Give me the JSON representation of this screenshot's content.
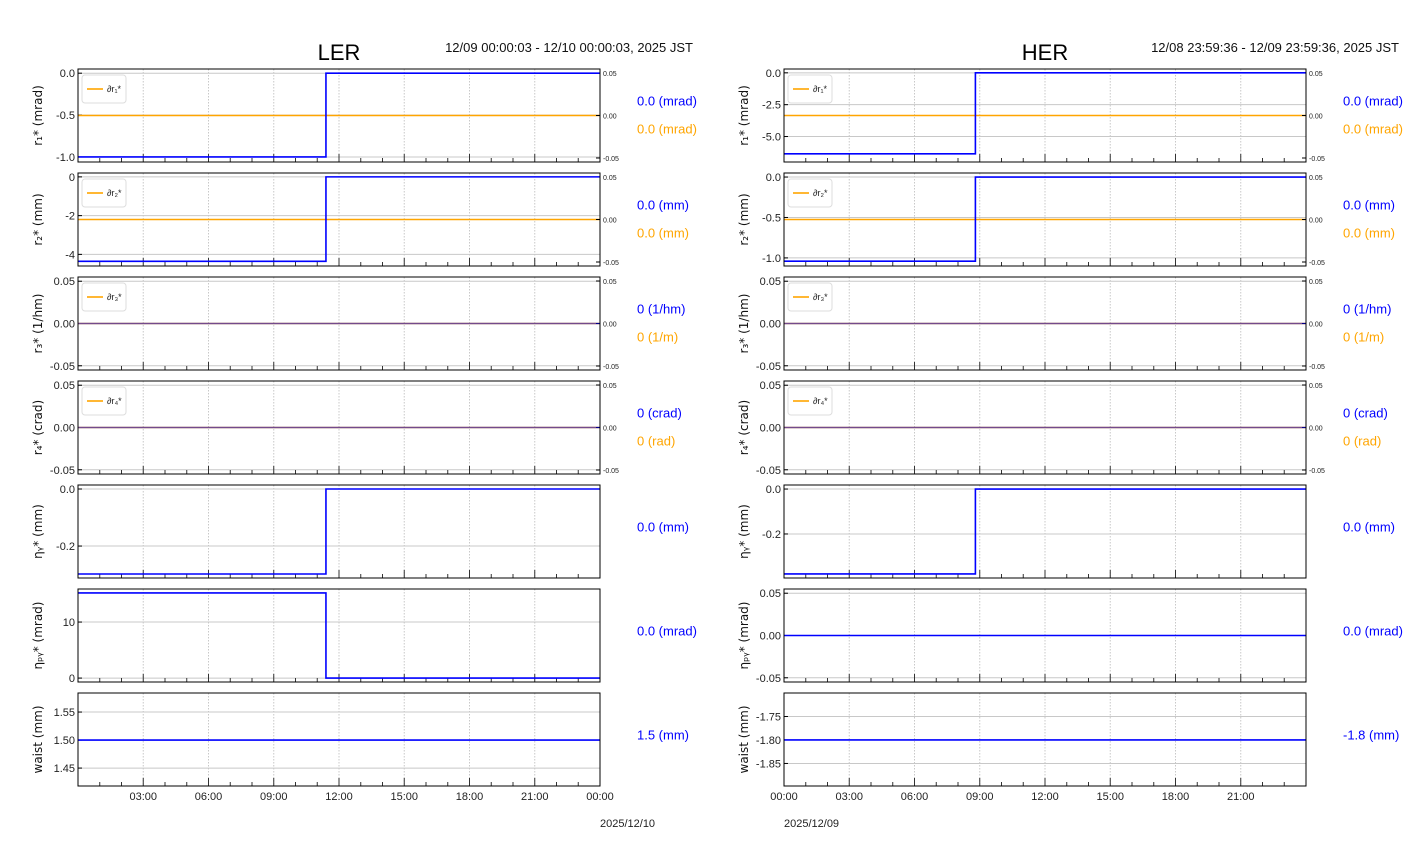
{
  "colors": {
    "blue": "#0000ff",
    "orange": "#ffa500",
    "grid": "#c8c8c8"
  },
  "chart_data": [
    {
      "type": "line",
      "title": "LER",
      "range_label": "12/09 00:00:03 - 12/10 00:00:03, 2025 JST",
      "date_label": "2025/12/10",
      "x_unit": "hours since 12/09 00:00:03",
      "xlim": [
        0,
        24
      ],
      "xticks": [
        {
          "h": 3,
          "label": "03:00"
        },
        {
          "h": 6,
          "label": "06:00"
        },
        {
          "h": 9,
          "label": "09:00"
        },
        {
          "h": 12,
          "label": "12:00"
        },
        {
          "h": 15,
          "label": "15:00"
        },
        {
          "h": 18,
          "label": "18:00"
        },
        {
          "h": 21,
          "label": "21:00"
        },
        {
          "h": 24,
          "label": "00:00"
        }
      ],
      "panels": [
        {
          "ylabel": "r₁* (mrad)",
          "ylim": [
            -1.06,
            0.05
          ],
          "yticks": [
            "0.0",
            "-0.5",
            "-1.0"
          ],
          "ytick_values": [
            0,
            -0.5,
            -1.0
          ],
          "step_at": 11.4,
          "before": -1.0,
          "after": 0.0,
          "orange": {
            "legend": "∂r₁*",
            "value": 0.0,
            "right_ticks": [
              "0.05",
              "0.00",
              "-0.05"
            ]
          },
          "blue_label": "0.0 (mrad)",
          "orange_label": "0.0 (mrad)"
        },
        {
          "ylabel": "r₂* (mm)",
          "ylim": [
            -4.6,
            0.2
          ],
          "yticks": [
            "0",
            "-2",
            "-4"
          ],
          "ytick_values": [
            0,
            -2,
            -4
          ],
          "step_at": 11.4,
          "before": -4.36,
          "after": 0.0,
          "orange": {
            "legend": "∂r₂*",
            "value": 0.0,
            "right_ticks": [
              "0.05",
              "0.00",
              "-0.05"
            ]
          },
          "blue_label": "0.0 (mm)",
          "orange_label": "0.0 (mm)"
        },
        {
          "ylabel": "r₃* (1/hm)",
          "ylim": [
            -0.055,
            0.055
          ],
          "yticks": [
            "0.05",
            "0.00",
            "-0.05"
          ],
          "ytick_values": [
            0.05,
            0,
            -0.05
          ],
          "step_at": null,
          "before": 0,
          "after": 0,
          "orange": {
            "legend": "∂r₃*",
            "value": 0.0,
            "right_ticks": [
              "0.05",
              "0.00",
              "-0.05"
            ]
          },
          "blue_label": "0 (1/hm)",
          "orange_label": "0 (1/m)"
        },
        {
          "ylabel": "r₄* (crad)",
          "ylim": [
            -0.055,
            0.055
          ],
          "yticks": [
            "0.05",
            "0.00",
            "-0.05"
          ],
          "ytick_values": [
            0.05,
            0,
            -0.05
          ],
          "step_at": null,
          "before": 0,
          "after": 0,
          "orange": {
            "legend": "∂r₄*",
            "value": 0.0,
            "right_ticks": [
              "0.05",
              "0.00",
              "-0.05"
            ]
          },
          "blue_label": "0 (crad)",
          "orange_label": "0 (rad)"
        },
        {
          "ylabel": "ηᵧ* (mm)",
          "ylim": [
            -0.312,
            0.014
          ],
          "yticks": [
            "0.0",
            "-0.2"
          ],
          "ytick_values": [
            0,
            -0.2
          ],
          "step_at": 11.4,
          "before": -0.298,
          "after": 0.0,
          "orange": null,
          "blue_label": "0.0 (mm)"
        },
        {
          "ylabel": "ηₚᵧ* (mrad)",
          "ylim": [
            -0.7,
            15.9
          ],
          "yticks": [
            "10",
            "0"
          ],
          "ytick_values": [
            10,
            0
          ],
          "step_at": 11.4,
          "before": 15.2,
          "after": 0.0,
          "orange": null,
          "blue_label": "0.0 (mrad)"
        },
        {
          "ylabel": "waist (mm)",
          "ylim": [
            1.418,
            1.584
          ],
          "yticks": [
            "1.55",
            "1.50",
            "1.45"
          ],
          "ytick_values": [
            1.55,
            1.5,
            1.45
          ],
          "step_at": null,
          "before": 1.5,
          "after": 1.5,
          "orange": null,
          "blue_label": "1.5 (mm)"
        }
      ]
    },
    {
      "type": "line",
      "title": "HER",
      "range_label": "12/08 23:59:36 - 12/09 23:59:36, 2025 JST",
      "date_label": "2025/12/09",
      "x_unit": "hours since 12/09 00:00:00",
      "xlim": [
        0,
        24
      ],
      "xticks": [
        {
          "h": 0,
          "label": "00:00"
        },
        {
          "h": 3,
          "label": "03:00"
        },
        {
          "h": 6,
          "label": "06:00"
        },
        {
          "h": 9,
          "label": "09:00"
        },
        {
          "h": 12,
          "label": "12:00"
        },
        {
          "h": 15,
          "label": "15:00"
        },
        {
          "h": 18,
          "label": "18:00"
        },
        {
          "h": 21,
          "label": "21:00"
        }
      ],
      "panels": [
        {
          "ylabel": "r₁* (mrad)",
          "ylim": [
            -7.0,
            0.3
          ],
          "yticks": [
            "0.0",
            "-2.5",
            "-5.0"
          ],
          "ytick_values": [
            0,
            -2.5,
            -5.0
          ],
          "step_at": 8.8,
          "before": -6.36,
          "after": 0.0,
          "orange": {
            "legend": "∂r₁*",
            "value": 0.0,
            "right_ticks": [
              "0.05",
              "0.00",
              "-0.05"
            ]
          },
          "blue_label": "0.0 (mrad)",
          "orange_label": "0.0 (mrad)"
        },
        {
          "ylabel": "r₂* (mm)",
          "ylim": [
            -1.1,
            0.05
          ],
          "yticks": [
            "0.0",
            "-0.5",
            "-1.0"
          ],
          "ytick_values": [
            0,
            -0.5,
            -1.0
          ],
          "step_at": 8.8,
          "before": -1.04,
          "after": 0.0,
          "orange": {
            "legend": "∂r₂*",
            "value": 0.0,
            "right_ticks": [
              "0.05",
              "0.00",
              "-0.05"
            ]
          },
          "blue_label": "0.0 (mm)",
          "orange_label": "0.0 (mm)"
        },
        {
          "ylabel": "r₃* (1/hm)",
          "ylim": [
            -0.055,
            0.055
          ],
          "yticks": [
            "0.05",
            "0.00",
            "-0.05"
          ],
          "ytick_values": [
            0.05,
            0,
            -0.05
          ],
          "step_at": null,
          "before": 0,
          "after": 0,
          "orange": {
            "legend": "∂r₃*",
            "value": 0.0,
            "right_ticks": [
              "0.05",
              "0.00",
              "-0.05"
            ]
          },
          "blue_label": "0 (1/hm)",
          "orange_label": "0 (1/m)"
        },
        {
          "ylabel": "r₄* (crad)",
          "ylim": [
            -0.055,
            0.055
          ],
          "yticks": [
            "0.05",
            "0.00",
            "-0.05"
          ],
          "ytick_values": [
            0.05,
            0,
            -0.05
          ],
          "step_at": null,
          "before": 0,
          "after": 0,
          "orange": {
            "legend": "∂r₄*",
            "value": 0.0,
            "right_ticks": [
              "0.05",
              "0.00",
              "-0.05"
            ]
          },
          "blue_label": "0 (crad)",
          "orange_label": "0 (rad)"
        },
        {
          "ylabel": "ηᵧ* (mm)",
          "ylim": [
            -0.396,
            0.018
          ],
          "yticks": [
            "0.0",
            "-0.2"
          ],
          "ytick_values": [
            0,
            -0.2
          ],
          "step_at": 8.8,
          "before": -0.378,
          "after": 0.0,
          "orange": null,
          "blue_label": "0.0 (mm)"
        },
        {
          "ylabel": "ηₚᵧ* (mrad)",
          "ylim": [
            -0.055,
            0.055
          ],
          "yticks": [
            "0.05",
            "0.00",
            "-0.05"
          ],
          "ytick_values": [
            0.05,
            0,
            -0.05
          ],
          "step_at": null,
          "before": 0,
          "after": 0,
          "orange": null,
          "blue_label": "0.0 (mrad)"
        },
        {
          "ylabel": "waist (mm)",
          "ylim": [
            -1.898,
            -1.7
          ],
          "yticks": [
            "-1.75",
            "-1.80",
            "-1.85"
          ],
          "ytick_values": [
            -1.75,
            -1.8,
            -1.85
          ],
          "step_at": null,
          "before": -1.8,
          "after": -1.8,
          "orange": null,
          "blue_label": "-1.8 (mm)"
        }
      ]
    }
  ]
}
